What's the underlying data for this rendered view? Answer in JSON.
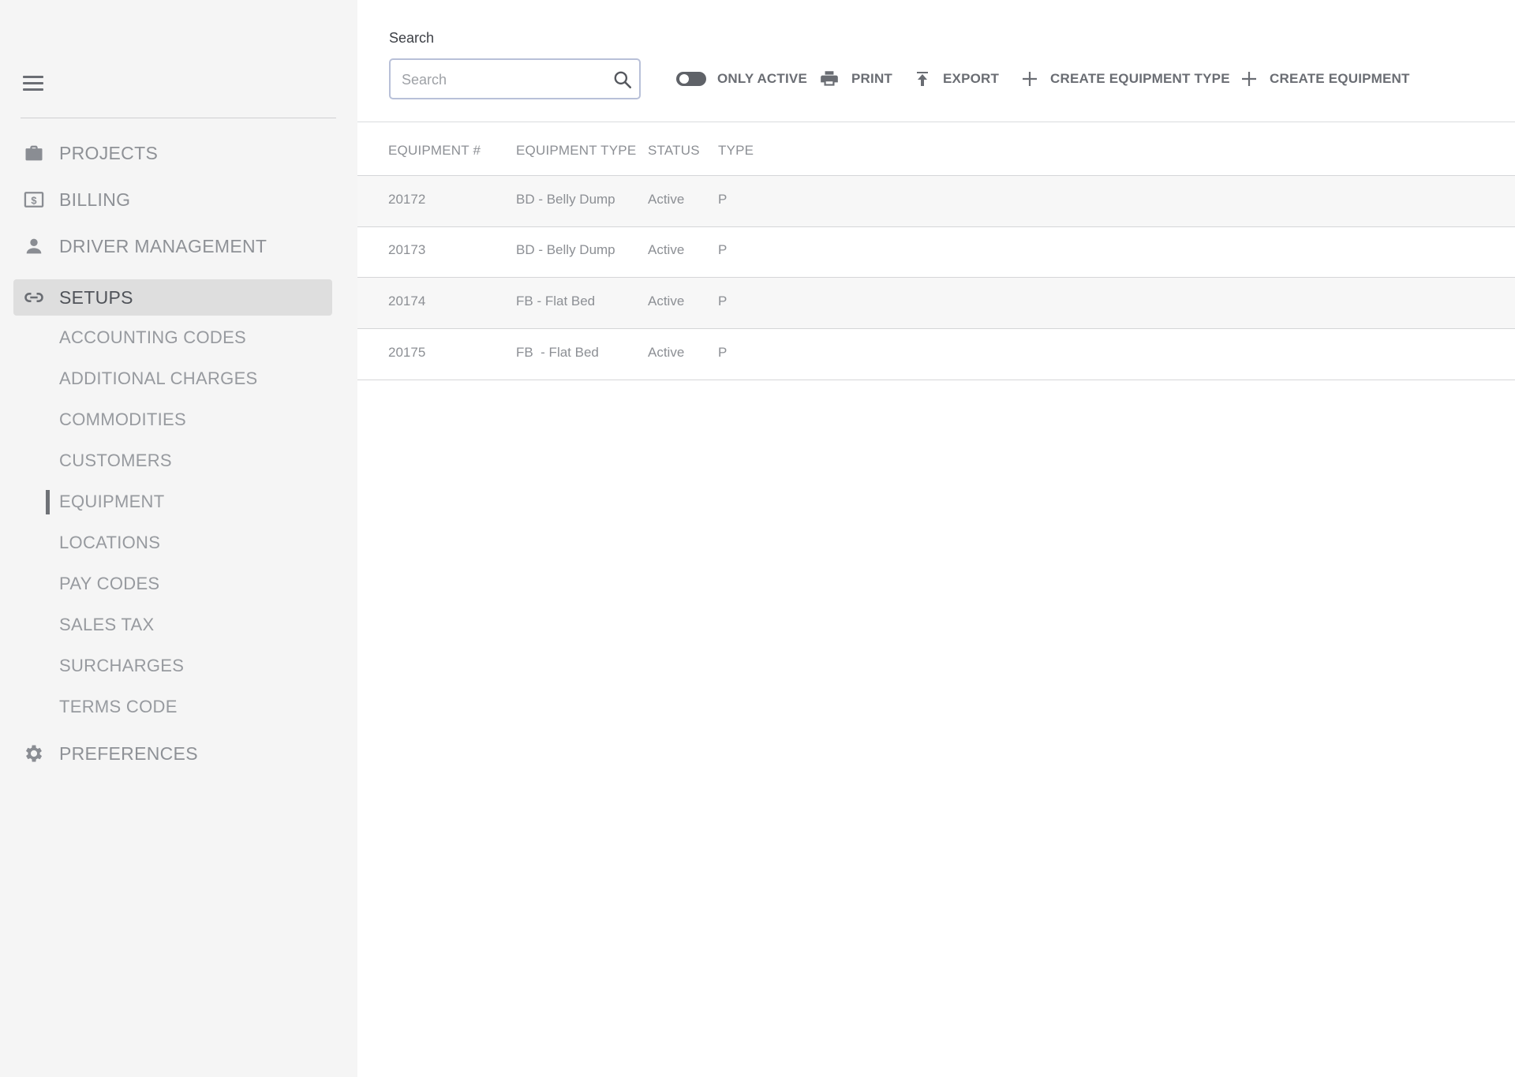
{
  "sidebar": {
    "nav": [
      {
        "label": "PROJECTS",
        "icon": "briefcase-icon"
      },
      {
        "label": "BILLING",
        "icon": "dollar-bill-icon"
      },
      {
        "label": "DRIVER MANAGEMENT",
        "icon": "person-icon"
      },
      {
        "label": "SETUPS",
        "icon": "link-icon"
      },
      {
        "label": "PREFERENCES",
        "icon": "gear-icon"
      }
    ],
    "setups_items": [
      "ACCOUNTING CODES",
      "ADDITIONAL CHARGES",
      "COMMODITIES",
      "CUSTOMERS",
      "EQUIPMENT",
      "LOCATIONS",
      "PAY CODES",
      "SALES TAX",
      "SURCHARGES",
      "TERMS CODE"
    ],
    "active_item": "EQUIPMENT"
  },
  "toolbar": {
    "search_label": "Search",
    "search_placeholder": "Search",
    "search_value": "",
    "only_active_label": "ONLY ACTIVE",
    "only_active_on": false,
    "print_label": "PRINT",
    "export_label": "EXPORT",
    "create_type_label": "CREATE EQUIPMENT TYPE",
    "create_equipment_label": "CREATE EQUIPMENT"
  },
  "table": {
    "columns": [
      "EQUIPMENT #",
      "EQUIPMENT TYPE",
      "STATUS",
      "TYPE"
    ],
    "rows": [
      [
        "20172",
        "BD - Belly Dump",
        "Active",
        "P"
      ],
      [
        "20173",
        "BD - Belly Dump",
        "Active",
        "P"
      ],
      [
        "20174",
        "FB - Flat Bed",
        "Active",
        "P"
      ],
      [
        "20175",
        "FB  - Flat Bed",
        "Active",
        "P"
      ]
    ]
  },
  "colors": {
    "sidebar_bg": "#f5f5f5",
    "active_nav_bg": "#dedede",
    "icon_gray": "#8a8d93",
    "search_border": "#b8c0d8"
  }
}
